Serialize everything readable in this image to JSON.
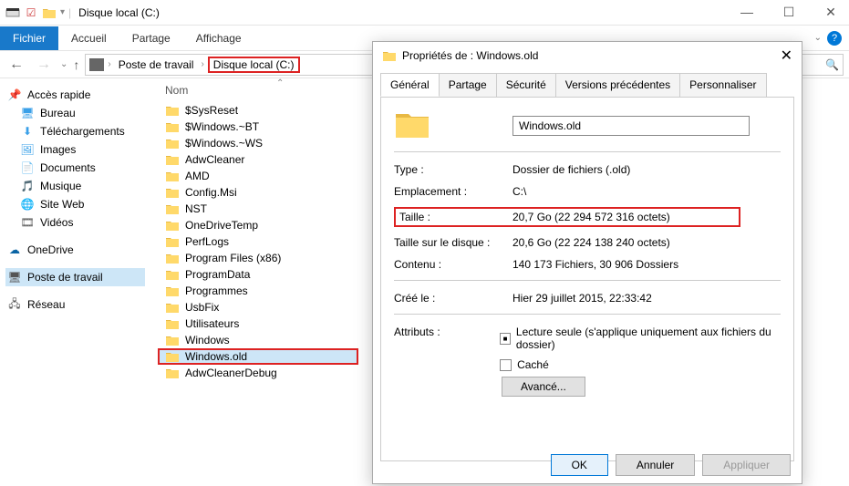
{
  "titlebar": {
    "title": "Disque local (C:)"
  },
  "ribbon": {
    "file": "Fichier",
    "home": "Accueil",
    "share": "Partage",
    "view": "Affichage"
  },
  "breadcrumb": {
    "item1": "Poste de travail",
    "item2": "Disque local (C:)"
  },
  "sidebar": {
    "quick": "Accès rapide",
    "desktop": "Bureau",
    "downloads": "Téléchargements",
    "pictures": "Images",
    "documents": "Documents",
    "music": "Musique",
    "siteweb": "Site Web",
    "videos": "Vidéos",
    "onedrive": "OneDrive",
    "thispc": "Poste de travail",
    "network": "Réseau"
  },
  "columns": {
    "name": "Nom"
  },
  "folders": [
    "$SysReset",
    "$Windows.~BT",
    "$Windows.~WS",
    "AdwCleaner",
    "AMD",
    "Config.Msi",
    "NST",
    "OneDriveTemp",
    "PerfLogs",
    "Program Files (x86)",
    "ProgramData",
    "Programmes",
    "UsbFix",
    "Utilisateurs",
    "Windows",
    "Windows.old",
    "AdwCleanerDebug"
  ],
  "dialog": {
    "title": "Propriétés de : Windows.old",
    "tabs": {
      "general": "Général",
      "share": "Partage",
      "security": "Sécurité",
      "prev": "Versions précédentes",
      "custom": "Personnaliser"
    },
    "name": "Windows.old",
    "type_l": "Type :",
    "type_v": "Dossier de fichiers (.old)",
    "loc_l": "Emplacement :",
    "loc_v": "C:\\",
    "size_l": "Taille :",
    "size_v": "20,7 Go (22 294 572 316 octets)",
    "sod_l": "Taille sur le disque :",
    "sod_v": "20,6 Go (22 224 138 240 octets)",
    "cont_l": "Contenu :",
    "cont_v": "140 173 Fichiers, 30 906 Dossiers",
    "created_l": "Créé le :",
    "created_v": "Hier 29 juillet 2015, 22:33:42",
    "attr_l": "Attributs :",
    "readonly": "Lecture seule (s'applique uniquement aux fichiers du dossier)",
    "hidden": "Caché",
    "advanced": "Avancé...",
    "ok": "OK",
    "cancel": "Annuler",
    "apply": "Appliquer"
  }
}
